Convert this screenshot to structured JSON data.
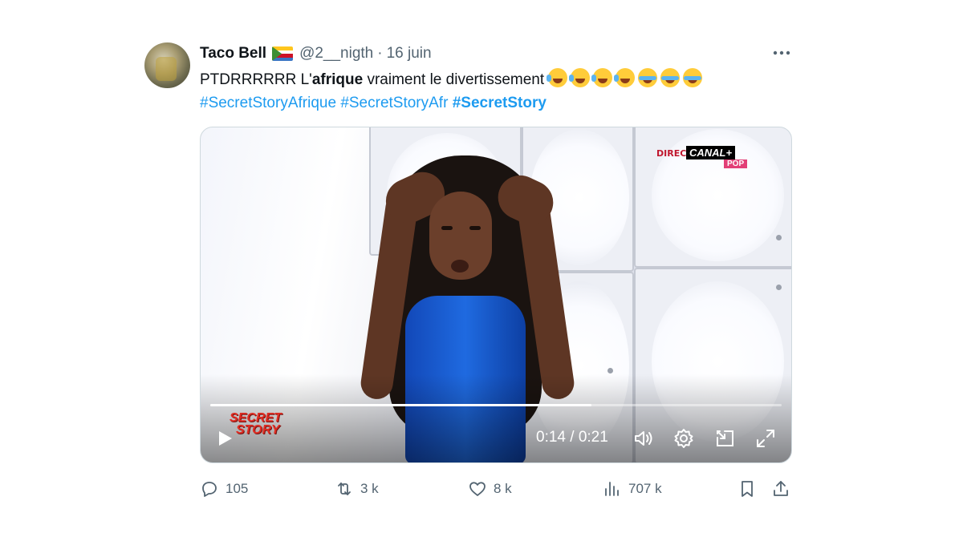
{
  "author": {
    "name": "Taco Bell",
    "handle": "@2__nigth",
    "separator": "·",
    "date": "16 juin"
  },
  "tweet": {
    "text_before": "PTDRRRRRR L'",
    "text_bold": "afrique",
    "text_after": " vraiment le divertissement ",
    "emojis": [
      "face-with-tears-of-joy",
      "face-with-tears-of-joy",
      "face-with-tears-of-joy",
      "face-with-tears-of-joy",
      "loudly-crying-face",
      "loudly-crying-face",
      "loudly-crying-face"
    ],
    "hashtags": [
      "#SecretStoryAfrique",
      "#SecretStoryAfr",
      "#SecretStory"
    ]
  },
  "video": {
    "channel_direct": "DIRECT",
    "channel_name": "CANAL+",
    "channel_sub": "POP",
    "show_logo_line1": "SECRET",
    "show_logo_line2": "STORY",
    "current_time": "0:14",
    "time_separator": " / ",
    "duration": "0:21",
    "progress_fraction": 0.667
  },
  "actions": {
    "replies": "105",
    "reposts": "3 k",
    "likes": "8 k",
    "views": "707 k"
  },
  "icons": {
    "more": "more-icon",
    "reply": "reply-icon",
    "repost": "repost-icon",
    "like": "heart-icon",
    "views": "views-icon",
    "bookmark": "bookmark-icon",
    "share": "share-icon",
    "play": "play-icon",
    "volume": "volume-icon",
    "settings": "gear-icon",
    "pip": "picture-in-picture-icon",
    "fullscreen": "fullscreen-icon"
  },
  "colors": {
    "link": "#1d9bf0",
    "muted": "#536471",
    "text": "#0f1419"
  }
}
